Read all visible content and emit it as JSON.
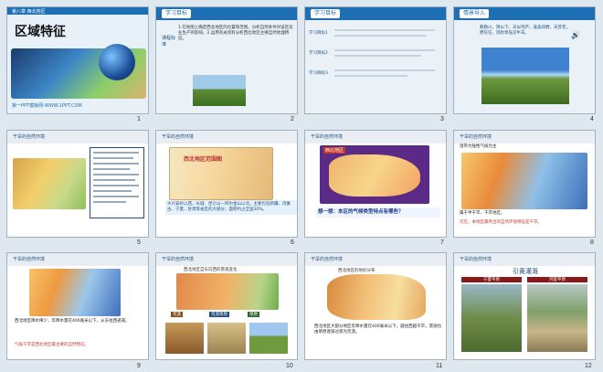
{
  "slides": [
    {
      "num": "1",
      "chapter": "第八章 西北地区",
      "title": "区域特征",
      "footer": "第一PPT模板网-WWW.1PPT.COM"
    },
    {
      "num": "2",
      "header": "学习目标",
      "lead": "课程标准",
      "text": "1.在地图上确定西北地区的位置和范围，分析自然条件对该区农业生产的影响。2.运用有关资料分析西北地区主要自然地理特征。"
    },
    {
      "num": "3",
      "header": "学习目标",
      "rows": [
        "学习目标1",
        "学习目标2",
        "学习目标3"
      ]
    },
    {
      "num": "4",
      "header": "情景导入",
      "poem": "敕勒川，阴山下。天似穹庐，笼盖四野。天苍苍，野茫茫，风吹草低见牛羊。"
    },
    {
      "num": "5",
      "header": "干旱的自然环境"
    },
    {
      "num": "6",
      "header": "干旱的自然环境",
      "maptitle": "西北地区范围图",
      "text": "大兴安岭以西，长城、昆仑山—阿尔金山以北，主要包括新疆、内蒙古、宁夏、甘肃等省区的大部分，面积约占全国30%。"
    },
    {
      "num": "7",
      "header": "干旱的自然环境",
      "maptitle": "西北地区",
      "question": "想一想：本区的气候类型特点有哪些？"
    },
    {
      "num": "8",
      "header": "干旱的自然环境",
      "top": "温带大陆性气候为主",
      "bottom": "属于半干旱、干旱地区。",
      "note": "可见，本地区最突出的自然环境特征是干旱。"
    },
    {
      "num": "9",
      "header": "干旱的自然环境",
      "text": "西北地区降水稀少，年降水量在400毫米以下，从东往西递减。",
      "note": "气候干旱是西北地区最主要的自然特征。"
    },
    {
      "num": "10",
      "header": "干旱的自然环境",
      "maptitle": "西北地区自东向西的景观变化",
      "labels": [
        "草原",
        "荒漠草原",
        "荒漠"
      ]
    },
    {
      "num": "11",
      "header": "干旱的自然环境",
      "maptitle": "西北地区的地形分布",
      "text": "西北地区大部分地区年降水量在400毫米以下，越往西越干旱，景观也由草原逐渐过渡为荒漠。"
    },
    {
      "num": "12",
      "header": "干旱的自然环境",
      "title": "引黄灌溉",
      "labels": [
        "宁夏平原",
        "河套平原"
      ]
    }
  ]
}
